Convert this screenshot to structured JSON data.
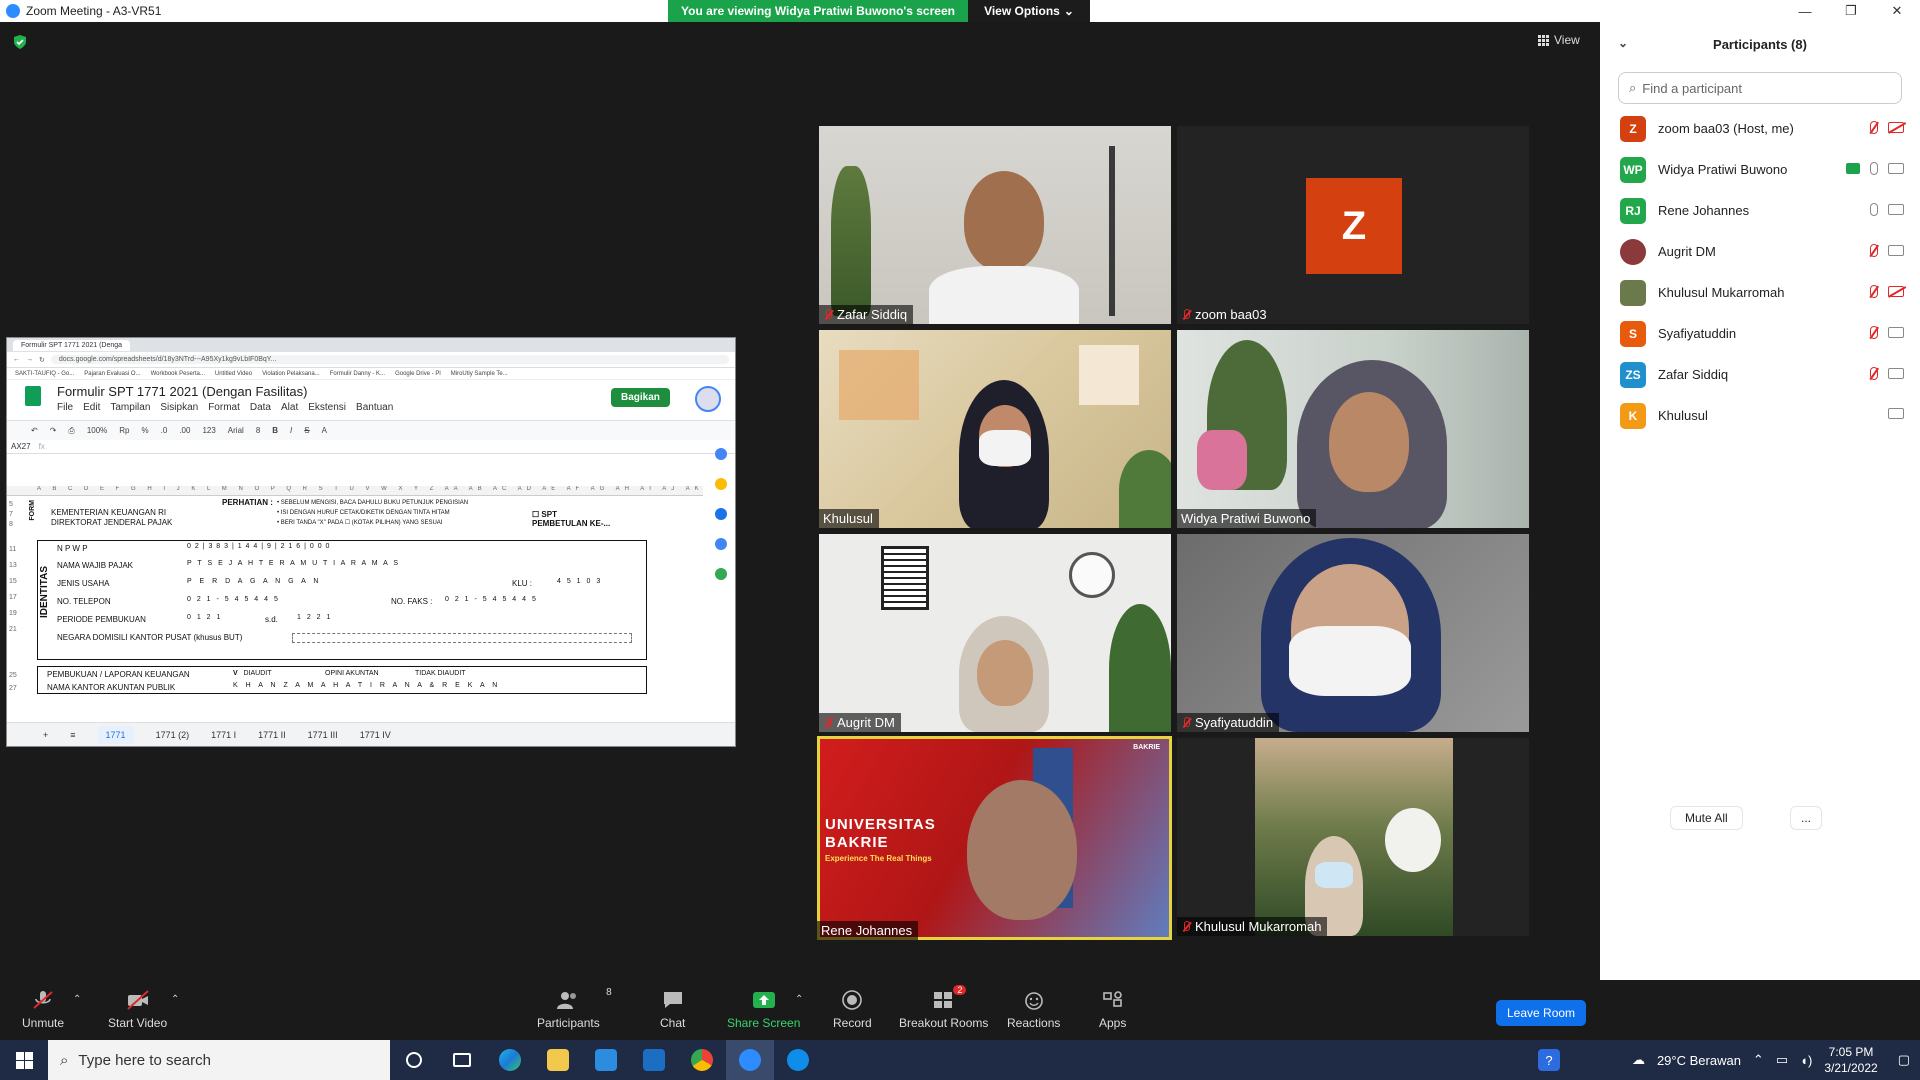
{
  "window": {
    "title": "Zoom Meeting - A3-VR51",
    "controls": [
      "—",
      "❐",
      "✕"
    ]
  },
  "share_banner": {
    "text": "You are viewing Widya Pratiwi Buwono's screen",
    "view_options": "View Options"
  },
  "stage": {
    "view_label": "View"
  },
  "shared_screen": {
    "browser_tab": "Formulir SPT 1771 2021 (Denga",
    "url": "docs.google.com/spreadsheets/d/18y3NTrd---A95Xy1kg9vLbIF0BqY...",
    "bookmarks": [
      "SAKTI-TAUFIQ - Go...",
      "Pajaran Evaluasi O...",
      "Workbook Peserta...",
      "Untitled Video",
      "Violation Pelaksana...",
      "Formulir Danny - K...",
      "Google Drive - Pl",
      "MiroUtiy Sample Te..."
    ],
    "doc_title": "Formulir SPT 1771 2021 (Dengan Fasilitas)",
    "menus": [
      "File",
      "Edit",
      "Tampilan",
      "Sisipkan",
      "Format",
      "Data",
      "Alat",
      "Ekstensi",
      "Bantuan"
    ],
    "share_button": "Bagikan",
    "toolbar": {
      "zoom": "100%",
      "currency": "Rp",
      "percent": "%",
      "dec1": ".0",
      "dec2": ".00",
      "format": "123",
      "font": "Arial",
      "size": "8"
    },
    "cell_ref": "AX27",
    "fx": "fx",
    "col_headers": "A B C D E F G H I J K L M N O P Q R S T U V W X Y Z AA AB AC AD AE AF AG AH AI AJ AK AL AM AN AO AP AQ AR",
    "form": {
      "ministry": "KEMENTERIAN KEUANGAN RI",
      "directorate": "DIREKTORAT JENDERAL PAJAK",
      "perhatian": "PERHATIAN :",
      "notes": [
        "• SEBELUM MENGISI, BACA DAHULU BUKU PETUNJUK PENGISIAN",
        "• ISI DENGAN HURUF CETAK/DIKETIK DENGAN TINTA HITAM",
        "• BERI TANDA \"X\" PADA",
        "(KOTAK PILIHAN) YANG SESUAI"
      ],
      "spt_pembetulan": "SPT PEMBETULAN KE-...",
      "identitas": "IDENTITAS",
      "row_numbers": [
        "5",
        "7",
        "8",
        "11",
        "13",
        "15",
        "17",
        "19",
        "21",
        "25",
        "27"
      ],
      "fields": [
        "N P W P",
        "NAMA WAJIB PAJAK",
        "JENIS USAHA",
        "NO. TELEPON",
        "PERIODE PEMBUKUAN",
        "NEGARA DOMISILI KANTOR PUSAT (khusus BUT)"
      ],
      "npwp_value": "0 2 | 3 8 3 | 1 4 4 | 9 | 2 1 6 | 0 0 0",
      "nama_value": "P T   S E J A H T E R A   M U T I A R A   M A S",
      "jenis_value": "P E R D A G A N G A N",
      "klu_label": "KLU :",
      "klu_value": "4 5 1 0 3",
      "telepon_value": "0 2 1  -  5 4 5 4 4 5",
      "fax_label": "NO. FAKS :",
      "fax_value": "0 2 1  -  5 4 5 4 4 5",
      "periode_from": "0 1 2 1",
      "sd": "s.d.",
      "periode_to": "1 2 2 1",
      "pembukuan_label": "PEMBUKUAN / LAPORAN KEUANGAN",
      "diaudit": "DIAUDIT",
      "opini": "OPINI AKUNTAN",
      "tidak_diaudit": "TIDAK DIAUDIT",
      "check_v": "V",
      "akuntan_label": "NAMA KANTOR AKUNTAN PUBLIK",
      "akuntan_value": "K H A N Z A   M A H A   T I R A N A   &   R E K A N",
      "form_side": "FORM"
    },
    "sheet_tabs": [
      "1771",
      "1771 (2)",
      "1771 I",
      "1771 II",
      "1771 III",
      "1771 IV"
    ]
  },
  "tiles": [
    {
      "name": "Zafar Siddiq",
      "muted": true
    },
    {
      "name": "zoom baa03",
      "muted": true,
      "avatar_letter": "Z"
    },
    {
      "name": "Khulusul",
      "muted": false
    },
    {
      "name": "Widya Pratiwi Buwono",
      "muted": false
    },
    {
      "name": "Augrit DM",
      "muted": true
    },
    {
      "name": "Syafiyatuddin",
      "muted": true
    },
    {
      "name": "Rene Johannes",
      "muted": false,
      "banner": [
        "UNIVERSITAS",
        "BAKRIE"
      ],
      "banner_sub": "Experience The Real Things",
      "logo": "BAKRIE"
    },
    {
      "name": "Khulusul Mukarromah",
      "muted": true
    }
  ],
  "panel": {
    "title": "Participants (8)",
    "search_placeholder": "Find a participant",
    "participants": [
      {
        "initials": "Z",
        "name": "zoom baa03 (Host, me)",
        "color": "#d4400f",
        "mic": "off",
        "cam": "off"
      },
      {
        "initials": "WP",
        "name": "Widya Pratiwi Buwono",
        "color": "#22a84a",
        "mic": "on",
        "cam": "on",
        "sharing": true
      },
      {
        "initials": "RJ",
        "name": "Rene Johannes",
        "color": "#22a84a",
        "mic": "on",
        "cam": "on"
      },
      {
        "initials": "",
        "name": "Augrit DM",
        "color": "#8a3a3a",
        "mic": "off",
        "cam": "on"
      },
      {
        "initials": "",
        "name": "Khulusul Mukarromah",
        "color": "#6b7a4a",
        "mic": "off",
        "cam": "off"
      },
      {
        "initials": "S",
        "name": "Syafiyatuddin",
        "color": "#e85a0c",
        "mic": "off",
        "cam": "on"
      },
      {
        "initials": "ZS",
        "name": "Zafar Siddiq",
        "color": "#1f8fce",
        "mic": "off",
        "cam": "on"
      },
      {
        "initials": "K",
        "name": "Khulusul",
        "color": "#f29a16",
        "mic": "none",
        "cam": "on"
      }
    ],
    "mute_all": "Mute All",
    "more": "..."
  },
  "toolbar": {
    "unmute": "Unmute",
    "start_video": "Start Video",
    "participants": "Participants",
    "participants_count": "8",
    "chat": "Chat",
    "share_screen": "Share Screen",
    "record": "Record",
    "breakout": "Breakout Rooms",
    "breakout_badge": "2",
    "reactions": "Reactions",
    "apps": "Apps",
    "leave": "Leave Room"
  },
  "taskbar": {
    "search_placeholder": "Type here to search",
    "weather": "29°C  Berawan",
    "time": "7:05 PM",
    "date": "3/21/2022"
  }
}
